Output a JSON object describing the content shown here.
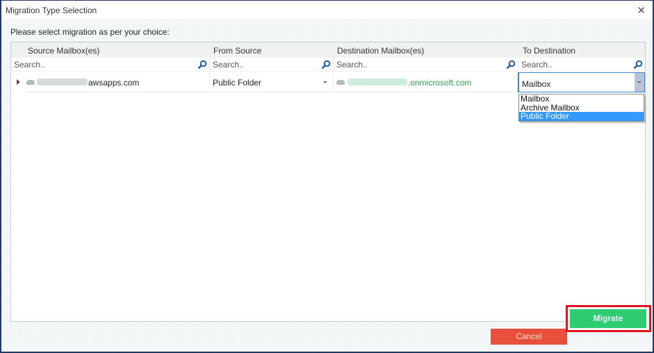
{
  "window": {
    "title": "Migration Type Selection",
    "close_icon": "close-icon"
  },
  "instruction": "Please select migration as per your choice:",
  "grid": {
    "columns": [
      {
        "header": "Source Mailbox(es)",
        "search_placeholder": "Search.."
      },
      {
        "header": "From Source",
        "search_placeholder": "Search.."
      },
      {
        "header": "Destination Mailbox(es)",
        "search_placeholder": "Search.."
      },
      {
        "header": "To Destination",
        "search_placeholder": "Search.."
      }
    ],
    "rows": [
      {
        "source_mailbox_visible": "awsapps.com",
        "from_source": "Public Folder",
        "destination_mailbox_visible": ".onmicrosoft.com",
        "to_destination": "Mailbox"
      }
    ]
  },
  "dropdown": {
    "options": [
      "Mailbox",
      "Archive Mailbox",
      "Public Folder"
    ],
    "highlighted": "Public Folder"
  },
  "buttons": {
    "cancel": "Cancel",
    "migrate": "Migrate"
  },
  "colors": {
    "cancel_bg": "#e94f3d",
    "migrate_bg": "#2ecc71",
    "highlight_frame": "#e0141c",
    "selection": "#3399ff",
    "destination_text": "#2ea44f"
  }
}
